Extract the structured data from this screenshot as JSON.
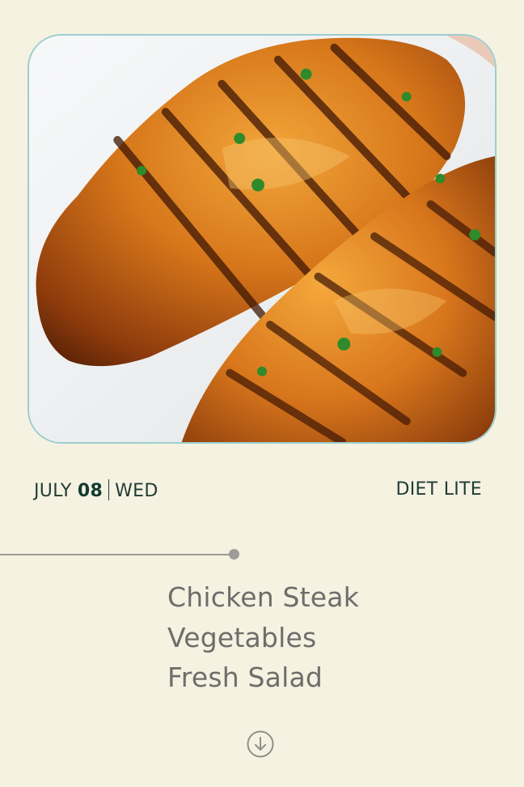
{
  "header": {
    "month": "JULY",
    "day": "08",
    "weekday": "WED",
    "plan": "DIET LITE"
  },
  "photo": {
    "icon": "grilled-chicken-photo"
  },
  "menu": {
    "items": [
      "Chicken Steak",
      "Vegetables",
      "Fresh Salad"
    ]
  },
  "controls": {
    "scroll_icon": "arrow-down-circle-icon"
  },
  "colors": {
    "background": "#f5f2e1",
    "accent_text": "#1f3b35",
    "menu_text": "#6d6d6b",
    "card_border": "#9ccfcf"
  }
}
